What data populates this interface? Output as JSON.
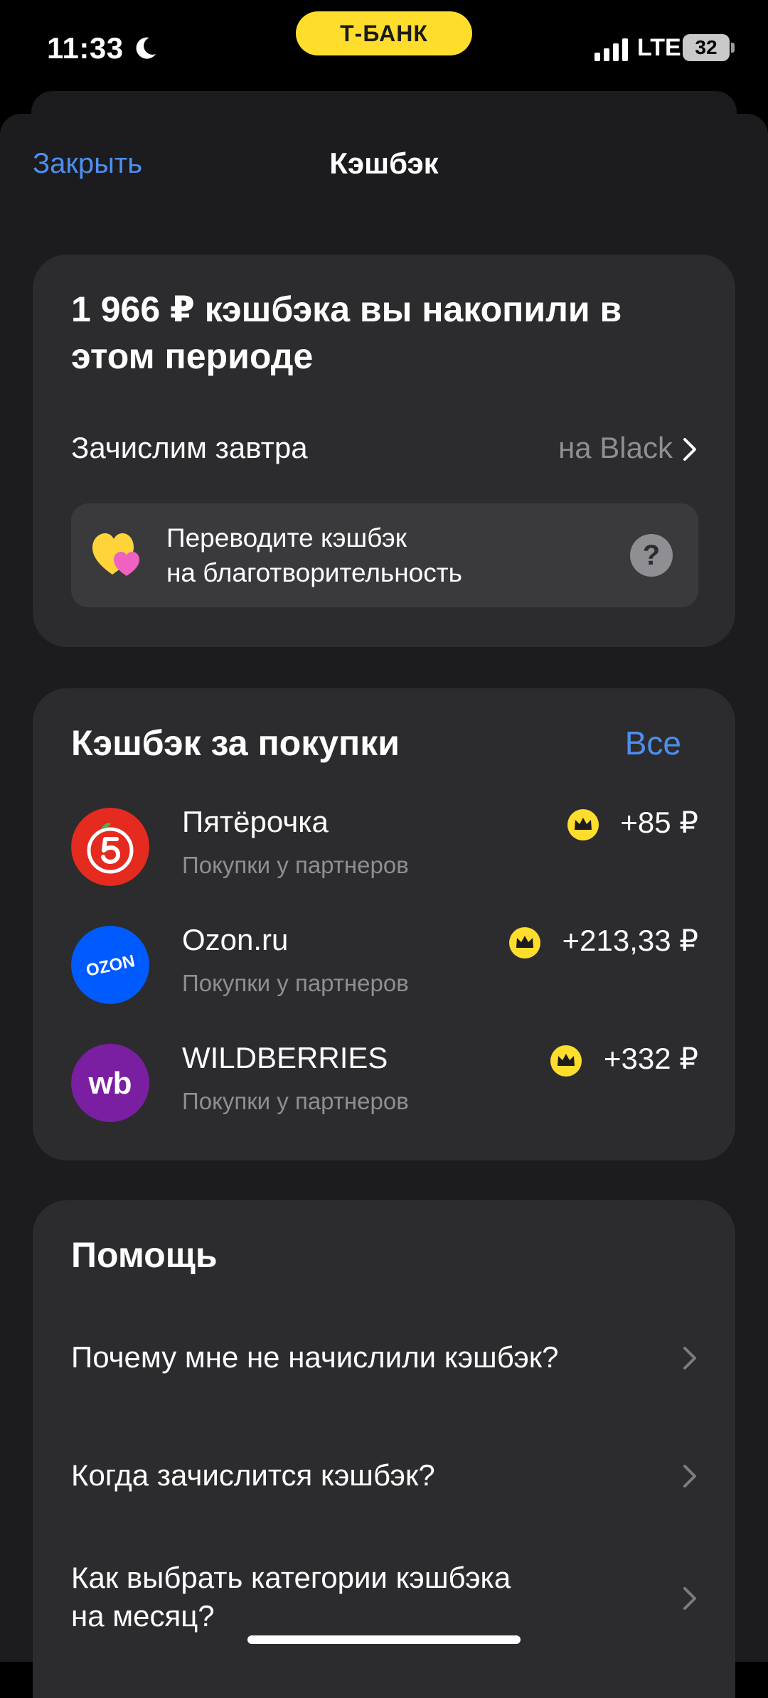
{
  "status_bar": {
    "time": "11:33",
    "bank_label": "Т-БАНК",
    "network": "LTE",
    "battery": "32"
  },
  "nav": {
    "close_label": "Закрыть",
    "title": "Кэшбэк"
  },
  "summary": {
    "title": "1 966 ₽ кэшбэка вы накопили в этом периоде",
    "credit_label": "Зачислим завтра",
    "credit_target": "на Black",
    "charity_line1": "Переводите кэшбэк",
    "charity_line2": "на благотворительность",
    "help_glyph": "?"
  },
  "purchases": {
    "title": "Кэшбэк за покупки",
    "all_label": "Все",
    "items": [
      {
        "name": "Пятёрочка",
        "subtitle": "Покупки у партнеров",
        "amount": "+85 ₽",
        "logo": "pyaterochka-logo",
        "logo_color": "#e52a1f"
      },
      {
        "name": "Ozon.ru",
        "subtitle": "Покупки у партнеров",
        "amount": "+213,33 ₽",
        "logo": "ozon-logo",
        "logo_color": "#005bff",
        "logo_text": "OZON"
      },
      {
        "name": "WILDBERRIES",
        "subtitle": "Покупки у партнеров",
        "amount": "+332 ₽",
        "logo": "wildberries-logo",
        "logo_color": "#7b1fa2",
        "logo_text": "wb"
      }
    ]
  },
  "help": {
    "title": "Помощь",
    "items": [
      {
        "line1": "Почему мне не начислили кэшбэк?",
        "line2": ""
      },
      {
        "line1": "Когда зачислится кэшбэк?",
        "line2": ""
      },
      {
        "line1": "Как выбрать категории кэшбэка",
        "line2": "на месяц?"
      }
    ]
  },
  "colors": {
    "accent_blue": "#4d8ff0",
    "brand_yellow": "#ffdd2d",
    "card_bg": "#2c2c2e",
    "sheet_bg": "#1c1c1e",
    "secondary_text": "#8e8e93"
  }
}
